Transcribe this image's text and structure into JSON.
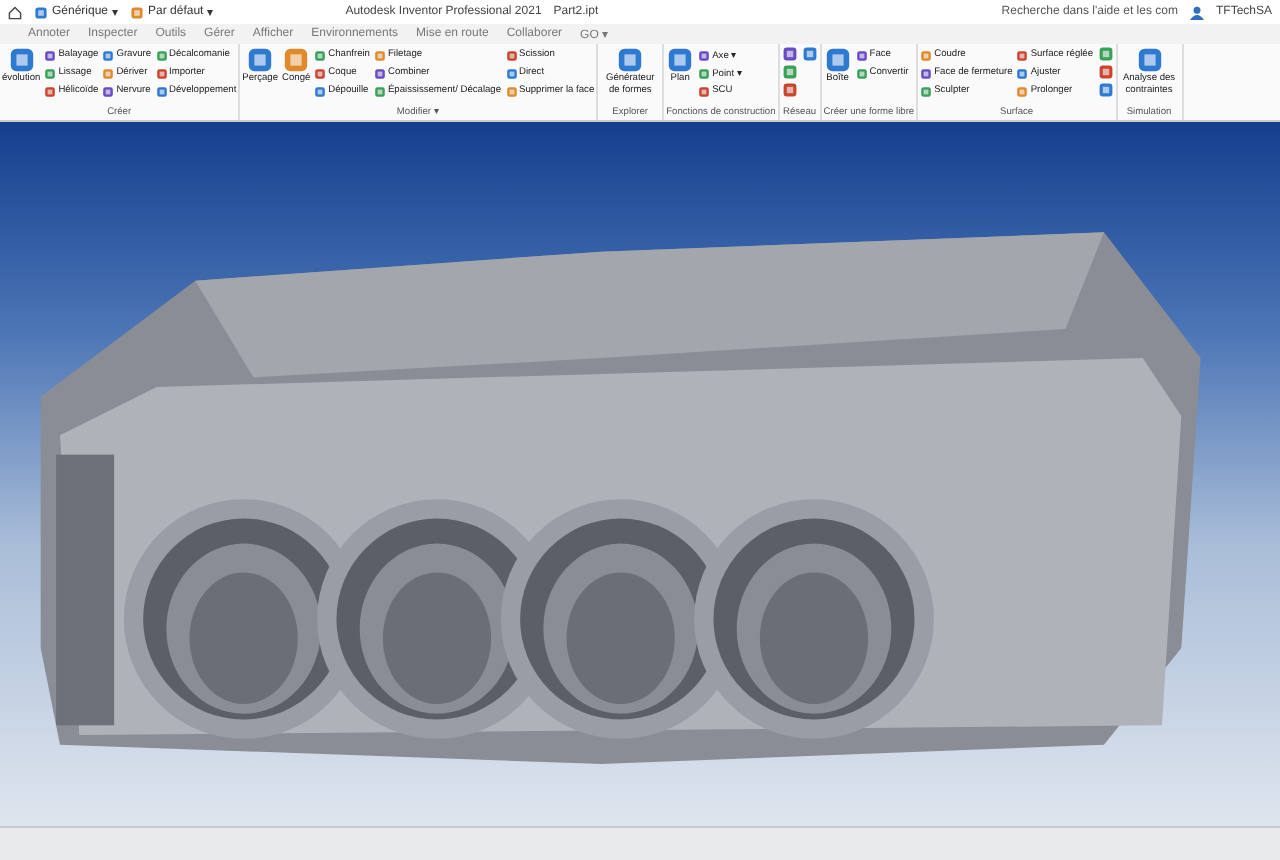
{
  "title_bar": {
    "quick_access": [
      {
        "label": "Générique",
        "caret": "▾"
      },
      {
        "label": "Par défaut",
        "caret": "▾"
      }
    ],
    "app_title": "Autodesk Inventor Professional 2021",
    "file_name": "Part2.ipt",
    "search": {
      "placeholder": "Recherche dans l'aide et les com"
    },
    "user": "TFTechSA"
  },
  "tabs": [
    {
      "label": "Annoter",
      "selected": false
    },
    {
      "label": "Inspecter",
      "selected": false
    },
    {
      "label": "Outils",
      "selected": false
    },
    {
      "label": "Gérer",
      "selected": false
    },
    {
      "label": "Afficher",
      "selected": false
    },
    {
      "label": "Environnements",
      "selected": false
    },
    {
      "label": "Mise en route",
      "selected": false
    },
    {
      "label": "Collaborer",
      "selected": false
    },
    {
      "label": "GO ▾",
      "selected": false
    }
  ],
  "ribbon": [
    {
      "label": "Créer",
      "items": [
        {
          "kind": "large",
          "label": "évolution"
        },
        {
          "kind": "small",
          "label": "Balayage"
        },
        {
          "kind": "small",
          "label": "Lissage"
        },
        {
          "kind": "small",
          "label": "Hélicoïde"
        },
        {
          "kind": "small",
          "label": "Gravure"
        },
        {
          "kind": "small",
          "label": "Dériver"
        },
        {
          "kind": "small",
          "label": "Nervure"
        },
        {
          "kind": "small",
          "label": "Décalcomanie"
        },
        {
          "kind": "small",
          "label": "Importer"
        },
        {
          "kind": "small",
          "label": "Développement"
        }
      ]
    },
    {
      "label": "Modifier ▾",
      "items": [
        {
          "kind": "large",
          "label": "Perçage"
        },
        {
          "kind": "large",
          "label": "Congé"
        },
        {
          "kind": "small",
          "label": "Chanfrein"
        },
        {
          "kind": "small",
          "label": "Coque"
        },
        {
          "kind": "small",
          "label": "Dépouille"
        },
        {
          "kind": "small",
          "label": "Filetage"
        },
        {
          "kind": "small",
          "label": "Combiner"
        },
        {
          "kind": "small",
          "label": "Épaississement/ Décalage"
        },
        {
          "kind": "small",
          "label": "Scission"
        },
        {
          "kind": "small",
          "label": "Direct"
        },
        {
          "kind": "small",
          "label": "Supprimer la face"
        }
      ]
    },
    {
      "label": "Explorer",
      "items": [
        {
          "kind": "large",
          "label": "Générateur de formes"
        }
      ]
    },
    {
      "label": "Fonctions de construction",
      "items": [
        {
          "kind": "large",
          "label": "Plan"
        },
        {
          "kind": "small",
          "label": "Axe ▾"
        },
        {
          "kind": "small",
          "label": "Point ▾"
        },
        {
          "kind": "small",
          "label": "SCU"
        }
      ]
    },
    {
      "label": "Réseau",
      "items": [
        {
          "kind": "icon"
        },
        {
          "kind": "icon"
        },
        {
          "kind": "icon"
        },
        {
          "kind": "icon"
        }
      ]
    },
    {
      "label": "Créer une forme libre",
      "items": [
        {
          "kind": "large",
          "label": "Boîte"
        },
        {
          "kind": "small",
          "label": "Face"
        },
        {
          "kind": "small",
          "label": "Convertir"
        }
      ]
    },
    {
      "label": "Surface",
      "items": [
        {
          "kind": "small",
          "label": "Coudre"
        },
        {
          "kind": "small",
          "label": "Face de fermeture"
        },
        {
          "kind": "small",
          "label": "Sculpter"
        },
        {
          "kind": "small",
          "label": "Surface réglée"
        },
        {
          "kind": "small",
          "label": "Ajuster"
        },
        {
          "kind": "small",
          "label": "Prolonger"
        },
        {
          "kind": "icon"
        },
        {
          "kind": "icon"
        },
        {
          "kind": "icon"
        }
      ]
    },
    {
      "label": "Simulation",
      "items": [
        {
          "kind": "large",
          "label": "Analyse des contraintes"
        }
      ]
    }
  ]
}
